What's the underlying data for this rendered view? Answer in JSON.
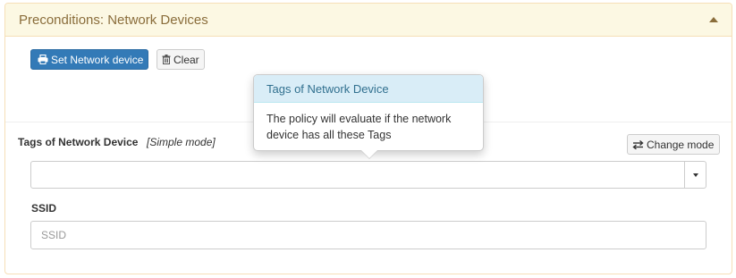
{
  "panel": {
    "title": "Preconditions: Network Devices",
    "collapse_icon": "caret-up-icon"
  },
  "toolbar": {
    "set_device_label": "Set Network device",
    "set_device_icon": "print-icon",
    "clear_label": "Clear",
    "clear_icon": "trash-icon"
  },
  "tags_field": {
    "label": "Tags of Network Device",
    "mode": "[Simple mode]",
    "change_mode_label": "Change mode",
    "change_mode_icon": "exchange-icon",
    "value": ""
  },
  "ssid_field": {
    "label": "SSID",
    "placeholder": "SSID",
    "value": ""
  },
  "popover": {
    "title": "Tags of Network Device",
    "content": "The policy will evaluate if the network device has all these Tags"
  },
  "colors": {
    "panel_heading_bg": "#fcf8e3",
    "panel_title": "#8a6d3b",
    "primary_button": "#337ab7",
    "popover_title_bg": "#d9edf7",
    "popover_title_text": "#31708f"
  }
}
